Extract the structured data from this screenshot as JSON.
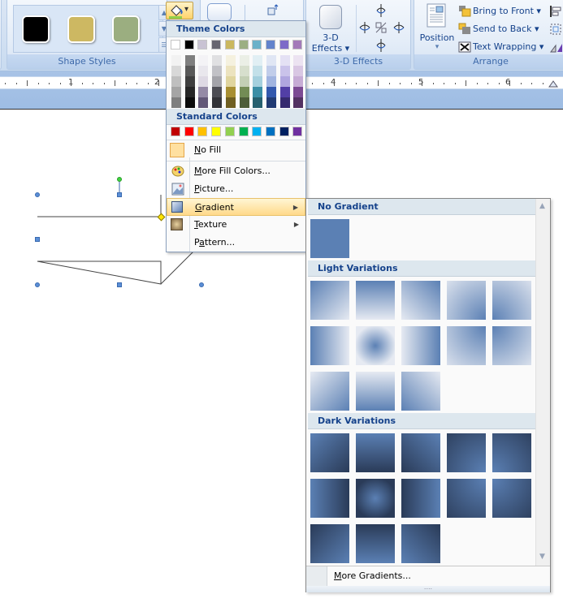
{
  "ribbon": {
    "shape_styles": {
      "label": "Shape Styles",
      "swatches": [
        "#000000",
        "#cdb862",
        "#9bae80"
      ],
      "scroll_up": "▲",
      "scroll_down": "▼",
      "more": "☰"
    },
    "shape_fill": {
      "icon": "paint-bucket-icon",
      "dropdown": "▾"
    },
    "effects_3d": {
      "button_label_line1": "3-D",
      "button_label_line2": "Effects ▾",
      "group_label": "3-D Effects"
    },
    "arrange": {
      "position_label": "Position",
      "position_arrow": "▾",
      "bring_to_front": "Bring to Front ▾",
      "send_to_back": "Send to Back ▾",
      "text_wrapping": "Text Wrapping ▾",
      "group_label": "Arrange"
    }
  },
  "ruler": {
    "numbers": [
      "1",
      "2",
      "4",
      "5",
      "6"
    ]
  },
  "fill_menu": {
    "theme_colors_label": "Theme Colors",
    "theme_top": [
      "#ffffff",
      "#000000",
      "#c9c3d3",
      "#676670",
      "#cbb85f",
      "#9caf83",
      "#6ab1c9",
      "#6383cc",
      "#7c6ac8",
      "#a37ab9"
    ],
    "theme_shades": [
      [
        "#f2f2f2",
        "#d8d8d8",
        "#bfbfbf",
        "#a5a5a5",
        "#7f7f7f"
      ],
      [
        "#7f7f7f",
        "#595959",
        "#3f3f3f",
        "#262626",
        "#0c0c0c"
      ],
      [
        "#f4f3f6",
        "#e9e7ed",
        "#ded9e4",
        "#958aa6",
        "#635878"
      ],
      [
        "#e0e0e2",
        "#c1c1c6",
        "#a3a3a9",
        "#4d4d54",
        "#333338"
      ],
      [
        "#f5f1df",
        "#ece3bf",
        "#e0d59f",
        "#a88f33",
        "#705f22"
      ],
      [
        "#ebefe6",
        "#d7dfcd",
        "#c3cfb5",
        "#738c55",
        "#4d5d38"
      ],
      [
        "#e1eff4",
        "#c3e0e9",
        "#a5d0de",
        "#3b8ea6",
        "#27606f"
      ],
      [
        "#e0e6f4",
        "#c1cdea",
        "#a1b4e0",
        "#3358ad",
        "#223b73"
      ],
      [
        "#e4e1f4",
        "#cac3ea",
        "#b0a6df",
        "#523fa6",
        "#362a6f"
      ],
      [
        "#ece3f1",
        "#d9c7e3",
        "#c7acd5",
        "#7c4a93",
        "#533162"
      ]
    ],
    "standard_colors_label": "Standard Colors",
    "standard": [
      "#c00000",
      "#ff0000",
      "#ffc000",
      "#ffff00",
      "#92d050",
      "#00b050",
      "#00b0f0",
      "#0070c0",
      "#002060",
      "#7030a0"
    ],
    "items": [
      {
        "label": "No Fill",
        "accel": "N",
        "rest": "o Fill",
        "icon": "no-fill-icon"
      },
      {
        "label": "More Fill Colors...",
        "accel": "M",
        "rest": "ore Fill Colors...",
        "icon": "palette-icon"
      },
      {
        "label": "Picture...",
        "accel": "P",
        "rest": "icture...",
        "icon": "picture-icon"
      },
      {
        "label": "Gradient",
        "accel": "G",
        "rest": "radient",
        "icon": "gradient-icon",
        "submenu": "▶"
      },
      {
        "label": "Texture",
        "accel": "T",
        "rest": "exture",
        "icon": "texture-icon",
        "submenu": "▶"
      },
      {
        "label": "Pattern...",
        "pre": "P",
        "accel": "a",
        "rest": "ttern...",
        "icon": "pattern-icon"
      }
    ]
  },
  "gradient_menu": {
    "no_gradient_label": "No Gradient",
    "light_label": "Light Variations",
    "dark_label": "Dark Variations",
    "more_label_accel": "M",
    "more_label_rest": "ore Gradients...",
    "scroll_up": "▲",
    "scroll_down": "▼",
    "grip": "....",
    "base_color": "#5b80b4",
    "light_color": "#e6eaf2",
    "dark_color": "#2a3b58"
  }
}
